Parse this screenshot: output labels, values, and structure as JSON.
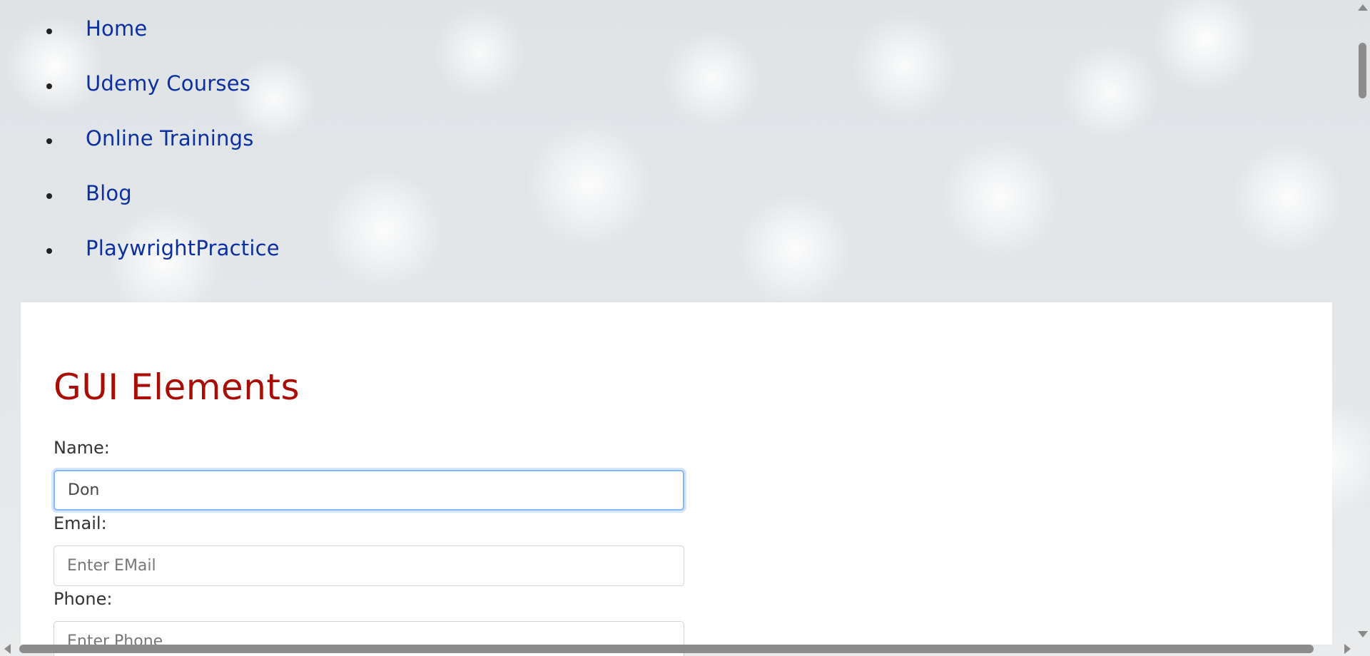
{
  "nav": {
    "items": [
      {
        "label": "Home"
      },
      {
        "label": "Udemy Courses"
      },
      {
        "label": "Online Trainings"
      },
      {
        "label": "Blog"
      },
      {
        "label": "PlaywrightPractice"
      }
    ]
  },
  "main": {
    "title": "GUI Elements",
    "fields": {
      "name": {
        "label": "Name:",
        "value": "Don",
        "placeholder": ""
      },
      "email": {
        "label": "Email:",
        "value": "",
        "placeholder": "Enter EMail"
      },
      "phone": {
        "label": "Phone:",
        "value": "",
        "placeholder": "Enter Phone"
      }
    }
  },
  "colors": {
    "link": "#0b2fa0",
    "title": "#a80d06",
    "focus_ring": "#86b7fe"
  }
}
